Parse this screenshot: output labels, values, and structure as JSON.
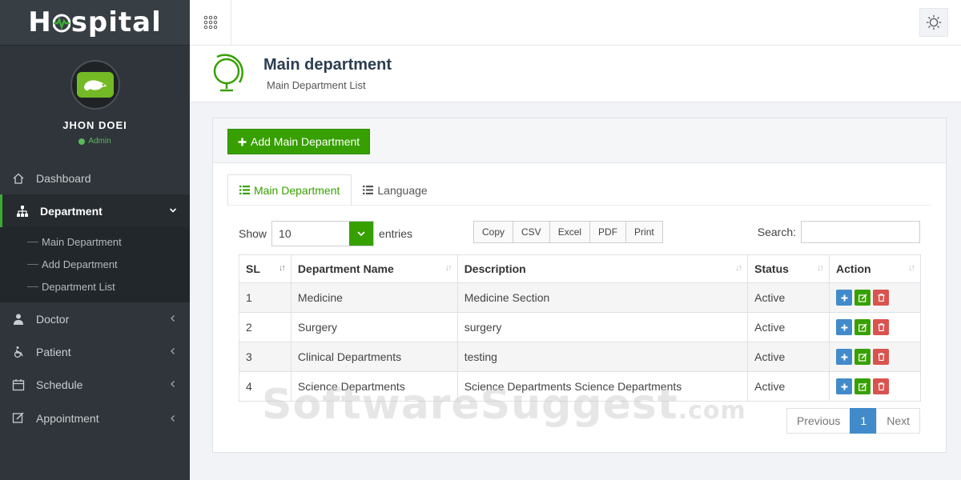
{
  "brand": {
    "name_prefix": "H",
    "name_suffix": "spital"
  },
  "profile": {
    "name": "JHON DOEI",
    "role": "Admin"
  },
  "sidebar": {
    "items": [
      {
        "label": "Dashboard",
        "icon": "home-icon"
      },
      {
        "label": "Department",
        "icon": "sitemap-icon"
      },
      {
        "label": "Doctor",
        "icon": "doctor-icon"
      },
      {
        "label": "Patient",
        "icon": "wheelchair-icon"
      },
      {
        "label": "Schedule",
        "icon": "calendar-icon"
      },
      {
        "label": "Appointment",
        "icon": "edit-icon"
      }
    ],
    "submenu": [
      {
        "label": "Main Department"
      },
      {
        "label": "Add Department"
      },
      {
        "label": "Department List"
      }
    ]
  },
  "header": {
    "title": "Main department",
    "subtitle": "Main Department List"
  },
  "panel": {
    "add_button": "Add Main Department",
    "tabs": [
      {
        "label": "Main Department"
      },
      {
        "label": "Language"
      }
    ],
    "show_label": "Show",
    "show_value": "10",
    "entries_label": "entries",
    "export_buttons": [
      "Copy",
      "CSV",
      "Excel",
      "PDF",
      "Print"
    ],
    "search_label": "Search:"
  },
  "table": {
    "columns": [
      "SL",
      "Department Name",
      "Description",
      "Status",
      "Action"
    ],
    "rows": [
      {
        "sl": "1",
        "name": "Medicine",
        "description": "Medicine Section",
        "status": "Active"
      },
      {
        "sl": "2",
        "name": "Surgery",
        "description": "surgery",
        "status": "Active"
      },
      {
        "sl": "3",
        "name": "Clinical Departments",
        "description": "testing",
        "status": "Active"
      },
      {
        "sl": "4",
        "name": "Science Departments",
        "description": "Science Departments Science Departments",
        "status": "Active"
      }
    ]
  },
  "pagination": {
    "previous": "Previous",
    "current": "1",
    "next": "Next"
  },
  "watermark": {
    "main": "SoftwareSuggest",
    "suffix": ".com"
  },
  "colors": {
    "accent": "#37a000",
    "primary": "#428bca",
    "danger": "#d9534f",
    "sidebar": "#2f353a"
  }
}
